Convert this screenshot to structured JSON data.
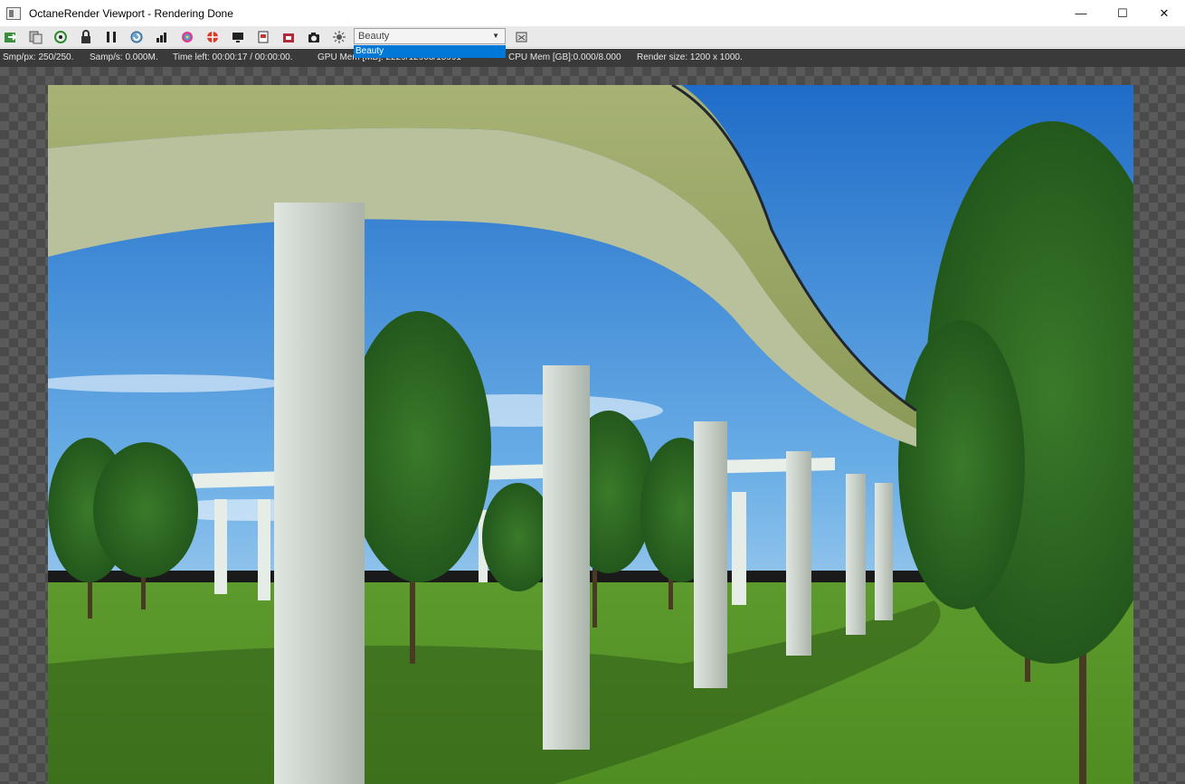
{
  "window": {
    "title": "OctaneRender Viewport - Rendering Done",
    "controls": {
      "minimize": "—",
      "maximize": "☐",
      "close": "✕"
    }
  },
  "toolbar": {
    "icons": [
      "export-render-icon",
      "copy-clipboard-icon",
      "recenter-view-icon",
      "lock-viewport-icon",
      "pause-render-icon",
      "restart-render-icon",
      "film-settings-icon",
      "color-picker-icon",
      "focus-picker-icon",
      "display-settings-icon",
      "imager-icon",
      "render-region-icon",
      "camera-icon",
      "brightness-icon"
    ],
    "pass_select": {
      "value": "Beauty",
      "dropdown_highlight": "Beauty"
    },
    "extra_icon": "render-pass-options-icon"
  },
  "status": {
    "samples_per_px": "Smp/px: 250/250.",
    "samples_per_sec": "Samp/s: 0.000M.",
    "time_left": "Time left: 00:00:17 / 00:00:00.",
    "gpu_mem": "GPU Mem [MB]: 2229/12903/15991 ",
    "cpu_mem": "CPU Mem [GB]:0.000/8.000",
    "render_size": "Render size: 1200 x 1000."
  },
  "colors": {
    "highlight": "#0078d7",
    "status_bg": "#3a3a3a",
    "toolbar_bg": "#e9e9e9",
    "sky": "#2f7fd6",
    "grass": "#4e8f2a",
    "concrete": "#c9d0c8"
  }
}
